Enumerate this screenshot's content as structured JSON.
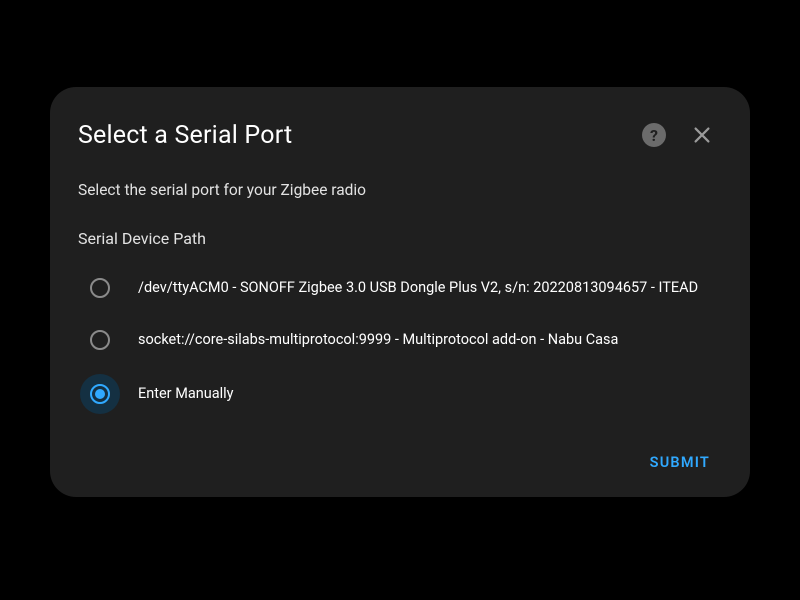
{
  "dialog": {
    "title": "Select a Serial Port",
    "subtitle": "Select the serial port for your Zigbee radio",
    "section_label": "Serial Device Path",
    "options": [
      {
        "label": "/dev/ttyACM0 - SONOFF Zigbee 3.0 USB Dongle Plus V2, s/n: 20220813094657 - ITEAD",
        "selected": false
      },
      {
        "label": "socket://core-silabs-multiprotocol:9999 - Multiprotocol add-on - Nabu Casa",
        "selected": false
      },
      {
        "label": "Enter Manually",
        "selected": true
      }
    ],
    "submit_label": "Submit",
    "help_glyph": "?",
    "close_glyph": "×"
  }
}
